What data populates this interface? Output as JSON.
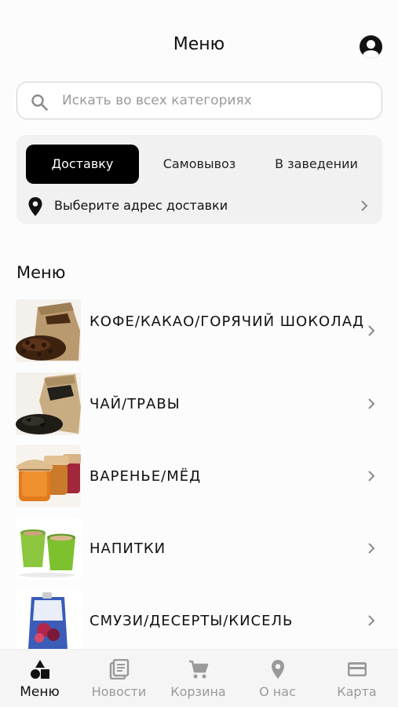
{
  "header": {
    "title": "Меню"
  },
  "search": {
    "placeholder": "Искать во всех категориях"
  },
  "delivery": {
    "modes": [
      "Доставку",
      "Самовывоз",
      "В заведении"
    ],
    "active_mode": "Доставку",
    "address_prompt": "Выберите адрес доставки"
  },
  "menu": {
    "title": "Меню",
    "categories": [
      {
        "name": "КОФЕ/КАКАО/ГОРЯЧИЙ ШОКОЛАД",
        "image": "coffee-beans-sack"
      },
      {
        "name": "ЧАЙ/ТРАВЫ",
        "image": "tea-leaves-sack"
      },
      {
        "name": "ВАРЕНЬЕ/МЁД",
        "image": "jam-jars"
      },
      {
        "name": "НАПИТКИ",
        "image": "drink-cups"
      },
      {
        "name": "СМУЗИ/ДЕСЕРТЫ/КИСЕЛЬ",
        "image": "smoothie-pouch"
      }
    ]
  },
  "tabbar": {
    "tabs": [
      {
        "label": "Меню",
        "icon": "menu-shapes-icon",
        "active": true
      },
      {
        "label": "Новости",
        "icon": "news-icon",
        "active": false
      },
      {
        "label": "Корзина",
        "icon": "cart-icon",
        "active": false
      },
      {
        "label": "О нас",
        "icon": "location-pin-icon",
        "active": false
      },
      {
        "label": "Карта",
        "icon": "card-icon",
        "active": false
      }
    ]
  },
  "colors": {
    "active": "#000000",
    "inactive": "#9a9a9a",
    "card_bg": "#f1f1f1"
  }
}
